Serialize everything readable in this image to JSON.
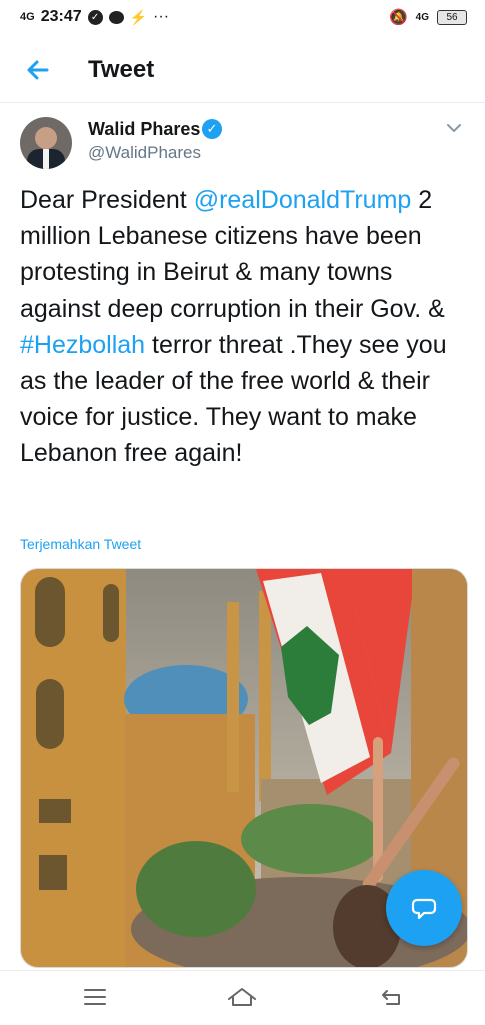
{
  "status_bar": {
    "signal": "4G",
    "time": "23:47",
    "more": "···",
    "network": "4G",
    "battery": "56"
  },
  "header": {
    "title": "Tweet"
  },
  "tweet": {
    "author_name": "Walid Phares",
    "author_handle": "@WalidPhares",
    "text": {
      "t1": "Dear President ",
      "mention": "@realDonaldTrump",
      "t2": " 2 million Lebanese citizens have been protesting in Beirut & many towns against deep corruption in their Gov. & ",
      "hashtag": "#Hezbollah",
      "t3": " terror threat .They see you as the leader of the free world & their voice for justice. They want to make Lebanon free again!"
    },
    "translate_label": "Terjemahkan Tweet"
  },
  "icons": {
    "back": "arrow-left-icon",
    "verified": "verified-badge-icon",
    "menu": "chevron-down-icon",
    "compose": "reply-bubble-icon",
    "nav_menu": "hamburger-icon",
    "nav_home": "home-icon",
    "nav_back": "return-icon"
  },
  "colors": {
    "accent": "#1da1f2",
    "text": "#14171a",
    "secondary": "#657786"
  }
}
